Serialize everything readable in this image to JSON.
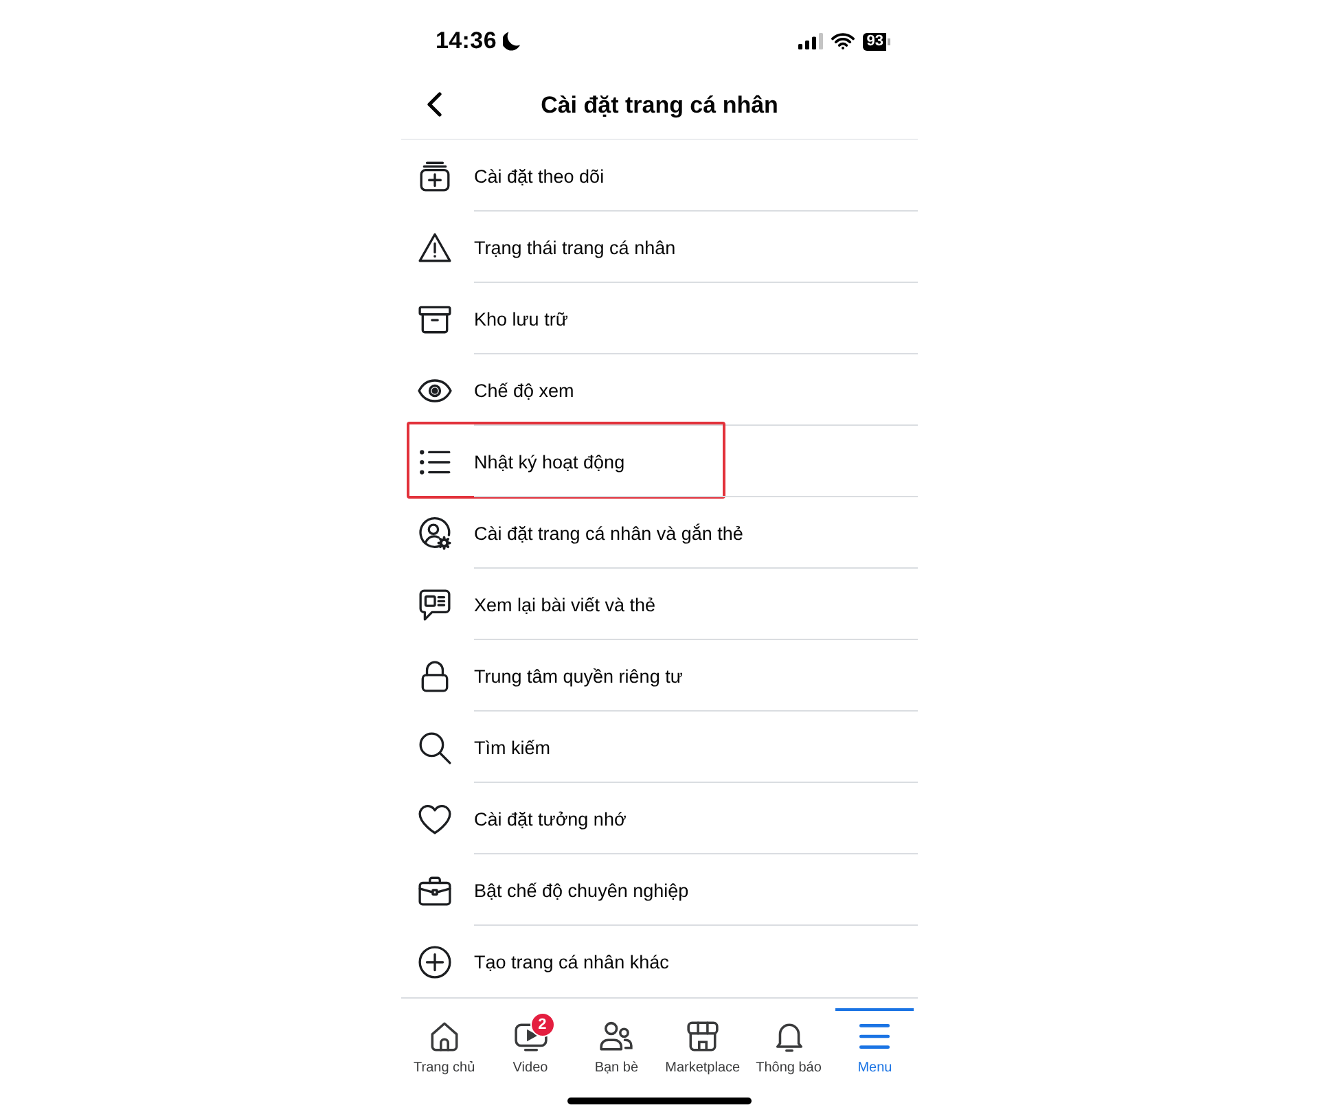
{
  "status_bar": {
    "time": "14:36",
    "battery": "93"
  },
  "header": {
    "title": "Cài đặt trang cá nhân"
  },
  "items": [
    {
      "label": "Cài đặt theo dõi",
      "highlighted": false
    },
    {
      "label": "Trạng thái trang cá nhân",
      "highlighted": false
    },
    {
      "label": "Kho lưu trữ",
      "highlighted": false
    },
    {
      "label": "Chế độ xem",
      "highlighted": false
    },
    {
      "label": "Nhật ký hoạt động",
      "highlighted": true
    },
    {
      "label": "Cài đặt trang cá nhân và gắn thẻ",
      "highlighted": false
    },
    {
      "label": "Xem lại bài viết và thẻ",
      "highlighted": false
    },
    {
      "label": "Trung tâm quyền riêng tư",
      "highlighted": false
    },
    {
      "label": "Tìm kiếm",
      "highlighted": false
    },
    {
      "label": "Cài đặt tưởng nhớ",
      "highlighted": false
    },
    {
      "label": "Bật chế độ chuyên nghiệp",
      "highlighted": false
    },
    {
      "label": "Tạo trang cá nhân khác",
      "highlighted": false
    }
  ],
  "tab_bar": {
    "tabs": [
      {
        "label": "Trang chủ",
        "selected": false
      },
      {
        "label": "Video",
        "selected": false,
        "badge": "2"
      },
      {
        "label": "Bạn bè",
        "selected": false
      },
      {
        "label": "Marketplace",
        "selected": false
      },
      {
        "label": "Thông báo",
        "selected": false
      },
      {
        "label": "Menu",
        "selected": true
      }
    ]
  }
}
